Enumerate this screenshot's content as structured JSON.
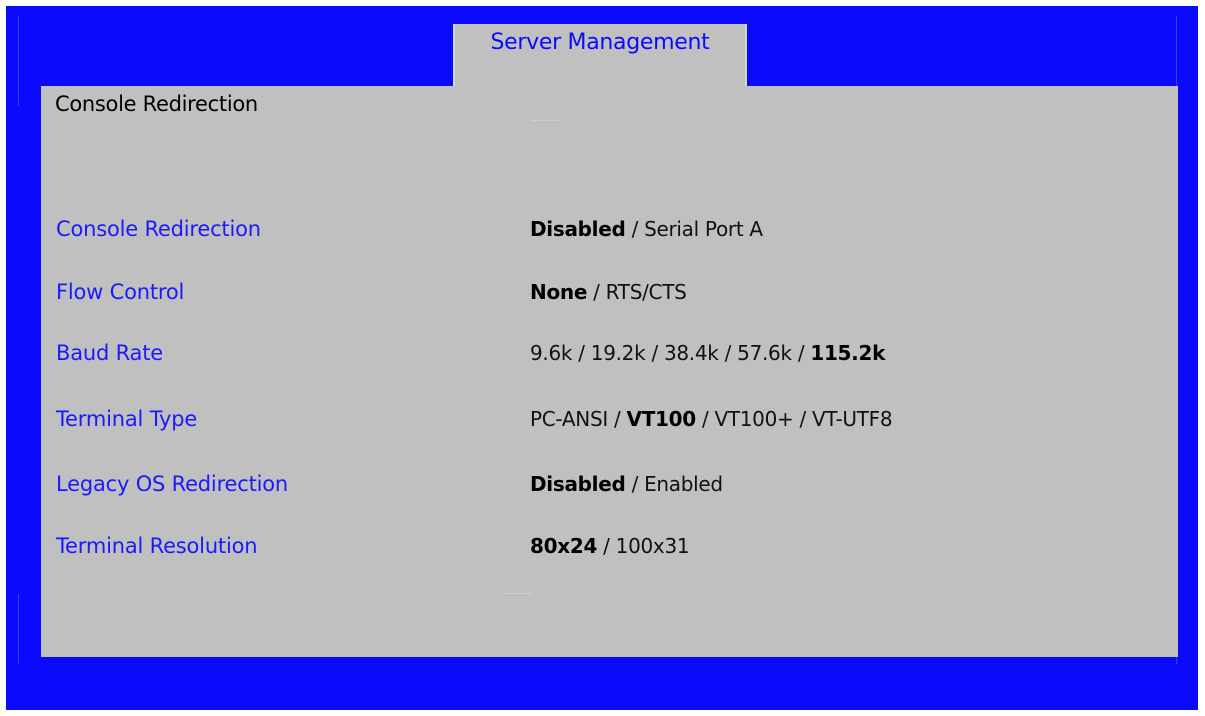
{
  "tab": {
    "label": "Server Management"
  },
  "page": {
    "title": "Console Redirection"
  },
  "settings": [
    {
      "label": "Console Redirection",
      "options": [
        {
          "text": "Disabled",
          "selected": true
        },
        {
          "text": "Serial Port A",
          "selected": false
        }
      ]
    },
    {
      "label": "Flow Control",
      "options": [
        {
          "text": "None",
          "selected": true
        },
        {
          "text": "RTS/CTS",
          "selected": false
        }
      ]
    },
    {
      "label": "Baud Rate",
      "options": [
        {
          "text": "9.6k",
          "selected": false
        },
        {
          "text": "19.2k",
          "selected": false
        },
        {
          "text": "38.4k",
          "selected": false
        },
        {
          "text": "57.6k",
          "selected": false
        },
        {
          "text": "115.2k",
          "selected": true
        }
      ]
    },
    {
      "label": "Terminal Type",
      "options": [
        {
          "text": "PC-ANSI",
          "selected": false
        },
        {
          "text": "VT100",
          "selected": true
        },
        {
          "text": "VT100+",
          "selected": false
        },
        {
          "text": "VT-UTF8",
          "selected": false
        }
      ]
    },
    {
      "label": "Legacy OS Redirection",
      "options": [
        {
          "text": "Disabled",
          "selected": true
        },
        {
          "text": "Enabled",
          "selected": false
        }
      ]
    },
    {
      "label": "Terminal Resolution",
      "options": [
        {
          "text": "80x24",
          "selected": true
        },
        {
          "text": "100x31",
          "selected": false
        }
      ]
    }
  ],
  "separator": " / ",
  "colors": {
    "frame": "#0a0aff",
    "panel": "#c0c0c0",
    "label": "#1a1aff",
    "value": "#000000"
  }
}
